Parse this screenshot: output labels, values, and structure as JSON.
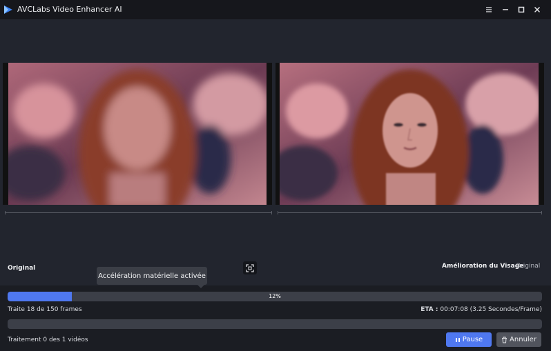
{
  "window": {
    "title": "AVCLabs Video Enhancer AI",
    "controls": [
      "menu-icon",
      "minimize-icon",
      "maximize-icon",
      "close-icon"
    ]
  },
  "preview": {
    "left_label": "Original",
    "right_label_primary": "Amélioration du Visage",
    "right_label_secondary": "Original"
  },
  "tooltip": {
    "text": "Accélération matérielle activée"
  },
  "progress": {
    "fraction": 0.12,
    "percent_label": "12%",
    "frames_text": "Traite 18 de 150 frames",
    "eta_label": "ETA :",
    "eta_value": "00:07:08 (3.25 Secondes/Frame)",
    "videos_text": "Traitement 0 des 1 vidéos"
  },
  "buttons": {
    "pause_label": "Pause",
    "cancel_label": "Annuler"
  },
  "colors": {
    "accent": "#4f78f0",
    "background": "#1f2128",
    "titlebar": "#16171c"
  }
}
